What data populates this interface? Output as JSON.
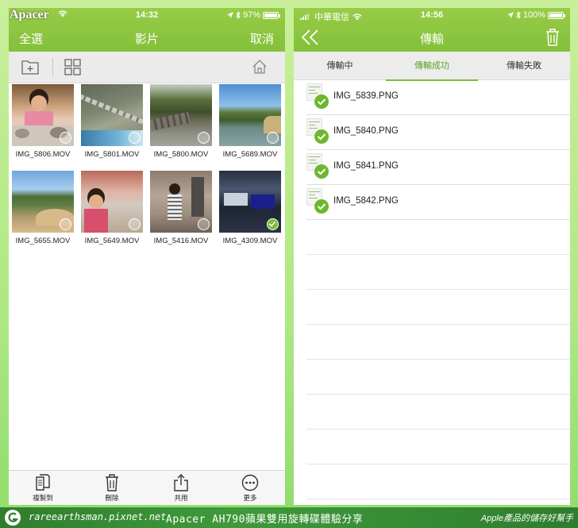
{
  "brand_watermark": "Apacer",
  "left": {
    "status": {
      "time": "14:32",
      "battery": "97%",
      "battery_level": 0.97
    },
    "nav": {
      "left": "全選",
      "title": "影片",
      "right": "取消"
    },
    "icons": [
      "add-folder-icon",
      "grid-view-icon",
      "home-icon"
    ],
    "videos": [
      {
        "name": "IMG_5806.MOV",
        "selected": false
      },
      {
        "name": "IMG_5801.MOV",
        "selected": false
      },
      {
        "name": "IMG_5800.MOV",
        "selected": false
      },
      {
        "name": "IMG_5689.MOV",
        "selected": false
      },
      {
        "name": "IMG_5655.MOV",
        "selected": false
      },
      {
        "name": "IMG_5649.MOV",
        "selected": false
      },
      {
        "name": "IMG_5416.MOV",
        "selected": false
      },
      {
        "name": "IMG_4309.MOV",
        "selected": true
      }
    ],
    "bottom": {
      "copy": "複製到",
      "delete": "刪除",
      "share": "共用",
      "more": "更多"
    }
  },
  "right": {
    "status": {
      "carrier": "中華電信",
      "time": "14:56",
      "battery": "100%",
      "battery_level": 1.0
    },
    "nav": {
      "title": "傳輸"
    },
    "tabs": [
      {
        "label": "傳輸中",
        "active": false
      },
      {
        "label": "傳輸成功",
        "active": true
      },
      {
        "label": "傳輸失敗",
        "active": false
      }
    ],
    "files": [
      {
        "name": "IMG_5839.PNG"
      },
      {
        "name": "IMG_5840.PNG"
      },
      {
        "name": "IMG_5841.PNG"
      },
      {
        "name": "IMG_5842.PNG"
      }
    ]
  },
  "banner": {
    "url": "rareearthsman.pixnet.net",
    "title": "Apacer AH790蘋果雙用旋轉碟體驗分享",
    "tagline": "Apple產品的儲存好幫手"
  },
  "colors": {
    "accent": "#84c03a",
    "active_tab": "#5aa31f",
    "check": "#6cb82c"
  }
}
